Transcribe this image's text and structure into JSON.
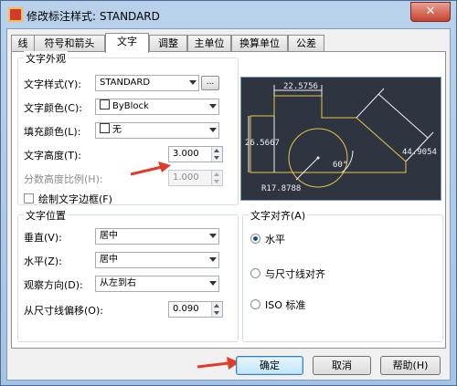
{
  "window": {
    "title": "修改标注样式: STANDARD",
    "close_glyph": "✕"
  },
  "tabs": [
    "线",
    "符号和箭头",
    "文字",
    "调整",
    "主单位",
    "换算单位",
    "公差"
  ],
  "active_tab": "文字",
  "appearance": {
    "title": "文字外观",
    "text_style_label": "文字样式(Y):",
    "text_style_value": "STANDARD",
    "browse_label": "...",
    "text_color_label": "文字颜色(C):",
    "text_color_value": "ByBlock",
    "fill_color_label": "填充颜色(L):",
    "fill_color_value": "无",
    "text_height_label": "文字高度(T):",
    "text_height_value": "3.000",
    "fraction_scale_label": "分数高度比例(H):",
    "fraction_scale_value": "1.000",
    "frame_label": "绘制文字边框(F)"
  },
  "placement": {
    "title": "文字位置",
    "vertical_label": "垂直(V):",
    "vertical_value": "居中",
    "horizontal_label": "水平(Z):",
    "horizontal_value": "居中",
    "view_dir_label": "观察方向(D):",
    "view_dir_value": "从左到右",
    "offset_label": "从尺寸线偏移(O):",
    "offset_value": "0.090"
  },
  "alignment": {
    "title": "文字对齐(A)",
    "options": [
      "水平",
      "与尺寸线对齐",
      "ISO 标准"
    ],
    "selected": "水平"
  },
  "preview": {
    "dim_top": "22.5756",
    "dim_left": "26.5667",
    "dim_right": "44.9054",
    "dim_angle": "60°",
    "dim_radius": "R17.8788"
  },
  "buttons": {
    "ok": "确定",
    "cancel": "取消",
    "help": "帮助(H)"
  },
  "colors": {
    "accent_arrow": "#e03a2a",
    "preview_bg": "#2e3540",
    "preview_line": "#e8c547"
  }
}
